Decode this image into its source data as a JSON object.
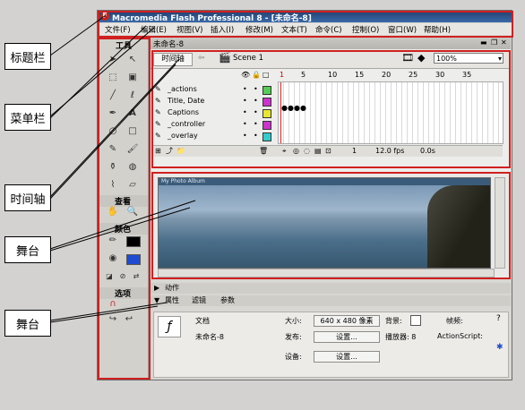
{
  "window": {
    "title": "Macromedia Flash Professional 8 - [未命名-8]",
    "logo": "F"
  },
  "menu": [
    "文件(F)",
    "编辑(E)",
    "视图(V)",
    "插入(I)",
    "修改(M)",
    "文本(T)",
    "命令(C)",
    "控制(O)",
    "窗口(W)",
    "帮助(H)"
  ],
  "callouts": {
    "title_bar": "标题栏",
    "menu_bar": "菜单栏",
    "timeline": "时间轴",
    "stage1": "舞台",
    "stage2": "舞台"
  },
  "toolbox": {
    "header": "工具",
    "view": "查看",
    "colors": "颜色",
    "options": "选项"
  },
  "document": {
    "tab": "未命名-8",
    "timeline_button": "时间轴",
    "scene": "Scene 1",
    "zoom": "100%"
  },
  "timeline": {
    "frame_numbers": [
      "1",
      "5",
      "10",
      "15",
      "20",
      "25",
      "30",
      "35"
    ],
    "layers": [
      {
        "name": "_actions",
        "color": "#55cc55"
      },
      {
        "name": "Title, Date",
        "color": "#cc33cc"
      },
      {
        "name": "Captions",
        "color": "#e6e633"
      },
      {
        "name": "_controller",
        "color": "#cc33cc"
      },
      {
        "name": "_overlay",
        "color": "#33cccc"
      }
    ],
    "current_frame": "1",
    "fps": "12.0 fps",
    "time": "0.0s"
  },
  "stage": {
    "photo_title": "My Photo Album"
  },
  "panels": {
    "actions": "动作",
    "tabs": [
      "属性",
      "滤镜",
      "参数"
    ],
    "doc_label": "文档",
    "doc_name": "未命名-8",
    "size_label": "大小:",
    "size_value": "640 x 480 像素",
    "publish_label": "发布:",
    "settings_button": "设置...",
    "device_label": "设备:",
    "device_button": "设置...",
    "bg_label": "背景:",
    "fps_label": "帧频:",
    "player_label": "播放器: 8",
    "actionscript_label": "ActionScript:"
  }
}
